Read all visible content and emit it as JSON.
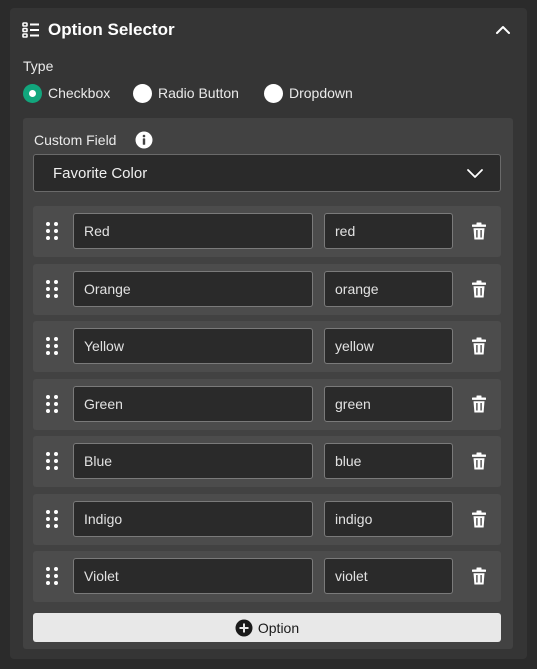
{
  "panel": {
    "title": "Option Selector",
    "title_icon": "list-icon",
    "collapse_icon": "chevron-up-icon"
  },
  "type_section": {
    "label": "Type",
    "options": [
      {
        "label": "Checkbox",
        "selected": true
      },
      {
        "label": "Radio Button",
        "selected": false
      },
      {
        "label": "Dropdown",
        "selected": false
      }
    ]
  },
  "custom_field": {
    "label": "Custom Field",
    "info_icon": "info-icon",
    "selected": "Favorite Color",
    "options": [
      {
        "label": "Red",
        "value": "red"
      },
      {
        "label": "Orange",
        "value": "orange"
      },
      {
        "label": "Yellow",
        "value": "yellow"
      },
      {
        "label": "Green",
        "value": "green"
      },
      {
        "label": "Blue",
        "value": "blue"
      },
      {
        "label": "Indigo",
        "value": "indigo"
      },
      {
        "label": "Violet",
        "value": "violet"
      }
    ],
    "add_label": "Option"
  },
  "colors": {
    "accent": "#12a67d",
    "panel": "#353535",
    "field_box": "#424242",
    "row": "#4c4c4c"
  }
}
